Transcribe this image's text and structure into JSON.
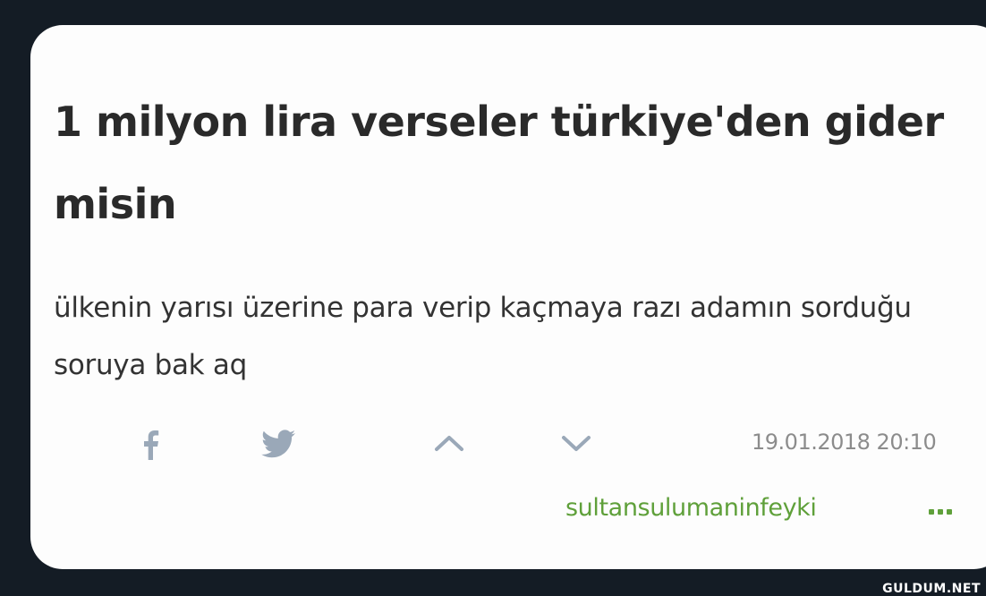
{
  "topic": {
    "title": "1 milyon lira verseler türkiye'den gider misin"
  },
  "entry": {
    "text": "ülkenin yarısı üzerine para verip kaçmaya razı adamın sorduğu soruya bak aq",
    "date": "19.01.2018 20:10",
    "author": "sultansulumaninfeyki"
  },
  "actions": {
    "share_facebook_icon": "facebook-icon",
    "share_twitter_icon": "twitter-icon",
    "upvote_icon": "chevron-up-icon",
    "downvote_icon": "chevron-down-icon",
    "more_icon": "ellipsis-icon"
  },
  "colors": {
    "background": "#141c25",
    "card": "#fdfdfd",
    "author": "#5fa03a",
    "icons": "#9aa8b8"
  },
  "watermark": "GULDUM.NET"
}
